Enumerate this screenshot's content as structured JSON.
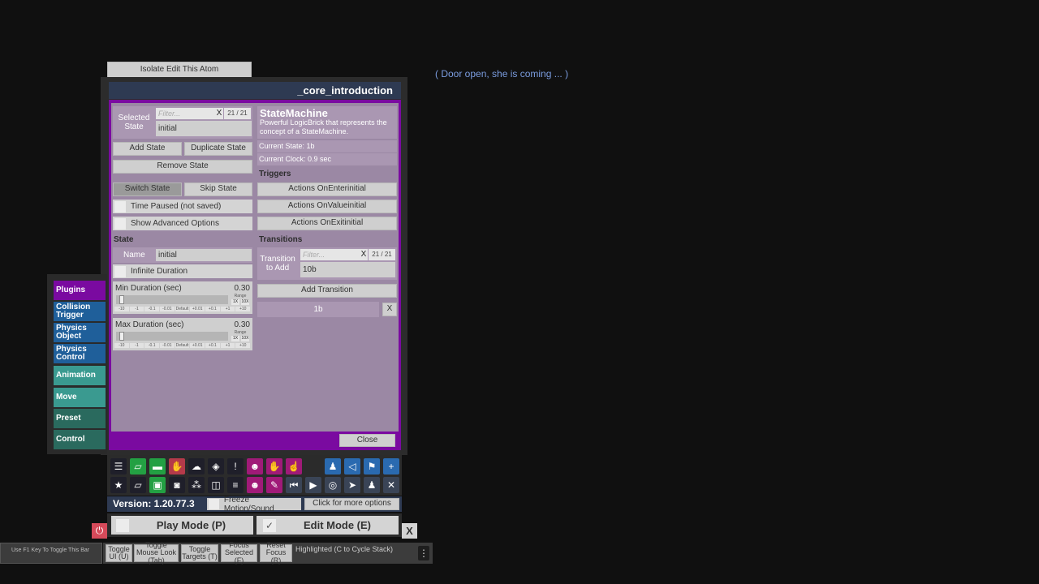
{
  "isolate_button": "Isolate Edit This Atom",
  "panel_title": "_core_introduction",
  "subtitle": "( Door open, she is coming ... )",
  "selected_state": {
    "label": "Selected State",
    "filter_placeholder": "Filter...",
    "filter_clear": "X",
    "count": "21 / 21",
    "value": "initial"
  },
  "buttons": {
    "add_state": "Add State",
    "duplicate_state": "Duplicate State",
    "remove_state": "Remove State",
    "switch_state": "Switch State",
    "skip_state": "Skip State",
    "add_transition": "Add Transition",
    "close": "Close"
  },
  "toggles": {
    "time_paused": "Time Paused (not saved)",
    "show_advanced": "Show Advanced Options",
    "infinite_duration": "Infinite Duration"
  },
  "state_section": {
    "header": "State",
    "name_label": "Name",
    "name_value": "initial"
  },
  "sliders": [
    {
      "label": "Min Duration (sec)",
      "value": "0.30",
      "range_label": "Range",
      "range_1x": "1X",
      "range_10x": "10X",
      "ticks": [
        "-10",
        "-1",
        "-0.1",
        "-0.01",
        "Default",
        "+0.01",
        "+0.1",
        "+1",
        "+10"
      ],
      "level": 0.03
    },
    {
      "label": "Max Duration (sec)",
      "value": "0.30",
      "range_label": "Range",
      "range_1x": "1X",
      "range_10x": "10X",
      "ticks": [
        "-10",
        "-1",
        "-0.1",
        "-0.01",
        "Default",
        "+0.01",
        "+0.1",
        "+1",
        "+10"
      ],
      "level": 0.03
    }
  ],
  "statemachine": {
    "title": "StateMachine",
    "description": "Powerful LogicBrick that represents the concept of a StateMachine.",
    "current_state": "Current State: 1b",
    "current_clock": "Current Clock: 0.9 sec"
  },
  "triggers": {
    "header": "Triggers",
    "on_enter": "Actions OnEnterinitial",
    "on_value": "Actions OnValueinitial",
    "on_exit": "Actions OnExitinitial"
  },
  "transitions": {
    "header": "Transitions",
    "add_label": "Transition to Add",
    "filter_placeholder": "Filter...",
    "filter_clear": "X",
    "count": "21 / 21",
    "value": "10b",
    "items": [
      {
        "name": "1b",
        "remove": "X"
      }
    ]
  },
  "tabs": [
    {
      "label": "Plugins",
      "color": "#7a0aa0"
    },
    {
      "label": "Collision Trigger",
      "color": "#1f5f9a"
    },
    {
      "label": "Physics Object",
      "color": "#1f5f9a"
    },
    {
      "label": "Physics Control",
      "color": "#1f5f9a"
    },
    {
      "label": "Animation",
      "color": "#3a9a90"
    },
    {
      "label": "Move",
      "color": "#3a9a90"
    },
    {
      "label": "Preset",
      "color": "#2a6a5e"
    },
    {
      "label": "Control",
      "color": "#2a6a5e"
    }
  ],
  "toolbar_row1": [
    "menu-icon",
    "scene-open-icon",
    "folder-icon",
    "hand-stop-icon",
    "cloud-icon",
    "cube-icon",
    "alert-icon",
    "person-add-icon",
    "hand-icon",
    "touch-icon",
    "person-icon",
    "unity-icon",
    "flag-icon",
    "plus-icon"
  ],
  "toolbar_row2": [
    "star-icon",
    "scene-icon",
    "screenshot-icon",
    "camera-icon",
    "graph-icon",
    "package-icon",
    "document-icon",
    "person-minus-icon",
    "wrench-icon",
    "skip-back-icon",
    "play-icon",
    "target-icon",
    "cursor-icon",
    "people-icon",
    "tools-icon"
  ],
  "version": "Version: 1.20.77.3",
  "freeze_motion": "Freeze Motion/Sound",
  "more_options": "Click for more options",
  "play_mode": "Play Mode (P)",
  "edit_mode": "Edit Mode (E)",
  "edit_check": "✓",
  "close_x": "X",
  "bottom_bar": {
    "hint": "Use F1 Key To Toggle This Bar",
    "toggle_ui": "Toggle UI (U)",
    "toggle_mouse": "Toggle Mouse Look (Tab)",
    "toggle_targets": "Toggle Targets (T)",
    "focus_selected": "Focus Selected (F)",
    "reset_focus": "Reset Focus (R)",
    "highlighted": "Highlighted (C to Cycle Stack)"
  },
  "colors": {
    "panel_purple": "#7a0aa0",
    "panel_body": "#9b88a4",
    "title_bar": "#2e3a52"
  }
}
